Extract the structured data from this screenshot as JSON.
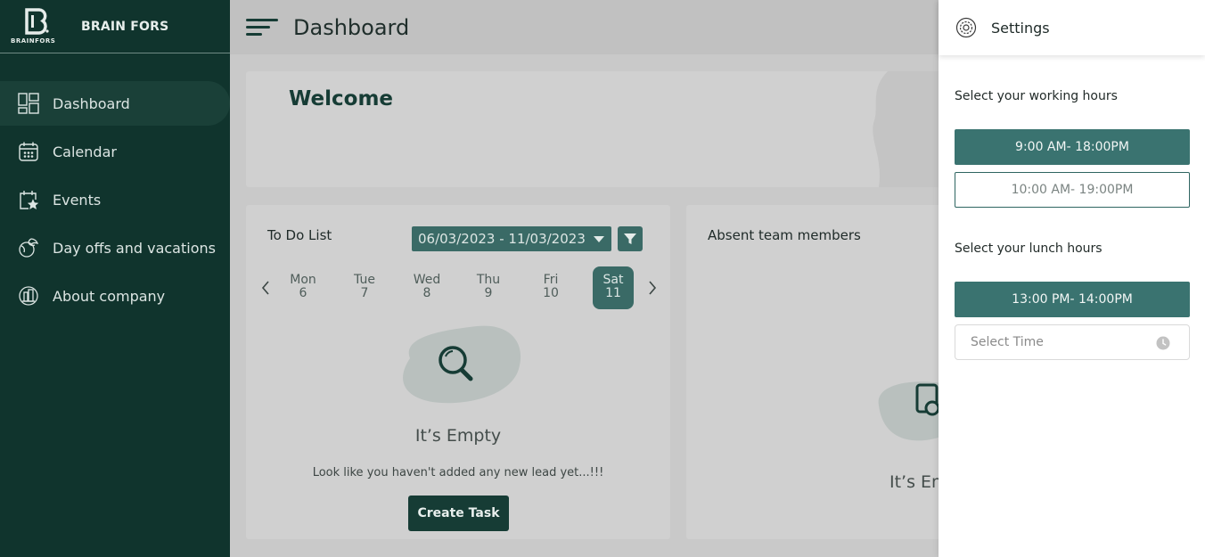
{
  "brand": {
    "name": "BRAIN FORS",
    "logo_text": "BRAINFORS"
  },
  "sidebar": {
    "items": [
      {
        "label": "Dashboard",
        "icon": "dashboard-icon",
        "active": true
      },
      {
        "label": "Calendar",
        "icon": "calendar-icon",
        "active": false
      },
      {
        "label": "Events",
        "icon": "events-icon",
        "active": false
      },
      {
        "label": "Day offs and vacations",
        "icon": "vacation-icon",
        "active": false
      },
      {
        "label": "About company",
        "icon": "company-icon",
        "active": false
      }
    ]
  },
  "header": {
    "title": "Dashboard"
  },
  "welcome": {
    "title": "Welcome"
  },
  "todo": {
    "title": "To Do List",
    "date_range": "06/03/2023 - 11/03/2023",
    "days": [
      {
        "name": "Mon",
        "num": "6"
      },
      {
        "name": "Tue",
        "num": "7"
      },
      {
        "name": "Wed",
        "num": "8"
      },
      {
        "name": "Thu",
        "num": "9"
      },
      {
        "name": "Fri",
        "num": "10"
      },
      {
        "name": "Sat",
        "num": "11"
      }
    ],
    "selected_day": "Sat",
    "empty_title": "It’s Empty",
    "empty_subtitle": "Look like you haven't added any new lead yet...!!!",
    "create_button": "Create Task"
  },
  "absent": {
    "title": "Absent team members",
    "empty_title": "It’s Em"
  },
  "settings": {
    "title": "Settings",
    "working_label": "Select your working hours",
    "working_options": [
      "9:00 AM- 18:00PM",
      "10:00 AM- 19:00PM"
    ],
    "working_selected": "9:00 AM- 18:00PM",
    "lunch_label": "Select your lunch hours",
    "lunch_option": "13:00 PM- 14:00PM",
    "time_placeholder": "Select Time"
  },
  "colors": {
    "sidebar_bg": "#10342d",
    "accent": "#3a7370",
    "overlay_bg": "#c9c9c9"
  }
}
